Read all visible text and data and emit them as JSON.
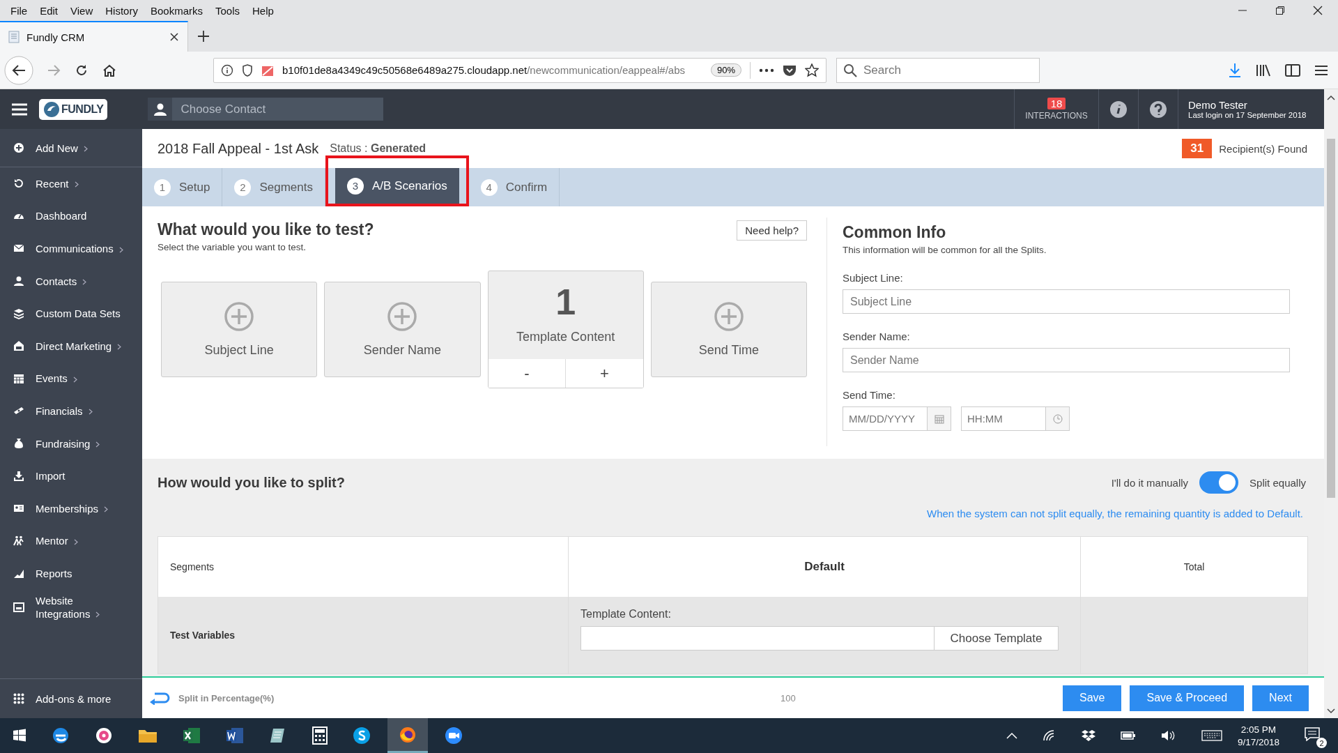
{
  "browser": {
    "menu": [
      "File",
      "Edit",
      "View",
      "History",
      "Bookmarks",
      "Tools",
      "Help"
    ],
    "tab": {
      "title": "Fundly CRM"
    },
    "url": {
      "host": "b10f01de8a4349c49c50568e6489a275.cloudapp.net",
      "path": "/newcommunication/eappeal#/abs"
    },
    "zoom": "90%",
    "search": {
      "placeholder": "Search"
    }
  },
  "header": {
    "logo": "FUNDLY",
    "contact_search": {
      "placeholder": "Choose Contact"
    },
    "interactions": {
      "count": "18",
      "label": "INTERACTIONS"
    },
    "user": {
      "name": "Demo Tester",
      "last_login": "Last login on 17 September 2018"
    }
  },
  "sidebar": {
    "items": [
      {
        "label": "Add New",
        "has_submenu": true
      },
      {
        "label": "Recent",
        "has_submenu": true
      },
      {
        "label": "Dashboard",
        "has_submenu": false
      },
      {
        "label": "Communications",
        "has_submenu": true
      },
      {
        "label": "Contacts",
        "has_submenu": true
      },
      {
        "label": "Custom Data Sets",
        "has_submenu": false
      },
      {
        "label": "Direct Marketing",
        "has_submenu": true
      },
      {
        "label": "Events",
        "has_submenu": true
      },
      {
        "label": "Financials",
        "has_submenu": true
      },
      {
        "label": "Fundraising",
        "has_submenu": true
      },
      {
        "label": "Import",
        "has_submenu": false
      },
      {
        "label": "Memberships",
        "has_submenu": true
      },
      {
        "label": "Mentor",
        "has_submenu": true
      },
      {
        "label": "Reports",
        "has_submenu": false
      },
      {
        "label": "Website Integrations",
        "has_submenu": true
      }
    ],
    "footer": "Add-ons & more"
  },
  "page": {
    "title": "2018 Fall Appeal - 1st Ask",
    "status": "Status : **Generated**",
    "recipients": {
      "count": "31",
      "label": "Recipient(s) Found"
    }
  },
  "steps": [
    {
      "number": "1",
      "label": "Setup",
      "selected": false,
      "highlighted": false
    },
    {
      "number": "2",
      "label": "Segments",
      "selected": false,
      "highlighted": false
    },
    {
      "number": "3",
      "label": "A/B Scenarios",
      "selected": true,
      "highlighted": true
    },
    {
      "number": "4",
      "label": "Confirm",
      "selected": false,
      "highlighted": false
    }
  ],
  "test": {
    "title": "What would you like to test?",
    "subtitle": "Select the variable you want to test.",
    "help_button": "Need help?",
    "variables": [
      {
        "label": "Subject Line"
      },
      {
        "label": "Sender Name"
      },
      {
        "label": "Template Content",
        "count": "1",
        "decrement": "-",
        "increment": "+"
      },
      {
        "label": "Send Time"
      }
    ]
  },
  "common_info": {
    "title": "Common Info",
    "subtitle": "This information will be common for all the Splits.",
    "fields": [
      {
        "label": "Subject Line:",
        "placeholder": "Subject Line"
      },
      {
        "label": "Sender Name:",
        "placeholder": "Sender Name"
      }
    ],
    "send_time": {
      "label": "Send Time:",
      "date_placeholder": "MM/DD/YYYY",
      "time_placeholder": "HH:MM"
    }
  },
  "split": {
    "title": "How would you like to split?",
    "manual_label": "I'll do it manually",
    "equal_label": "Split equally",
    "split_equally": true,
    "note": "When the system can not split equally, the remaining quantity is added to Default.",
    "table": {
      "columns": [
        "Segments",
        "Default",
        "Total"
      ],
      "test_row": {
        "label": "Test Variables",
        "field_label": "Template Content:",
        "button": "Choose Template"
      },
      "percentage_row": {
        "label": "Split in Percentage(%)",
        "value": "100"
      }
    }
  },
  "footer_buttons": [
    "Save",
    "Save & Proceed",
    "Next"
  ],
  "taskbar": {
    "time": "2:05 PM",
    "date": "9/17/2018",
    "notifications": "2"
  }
}
